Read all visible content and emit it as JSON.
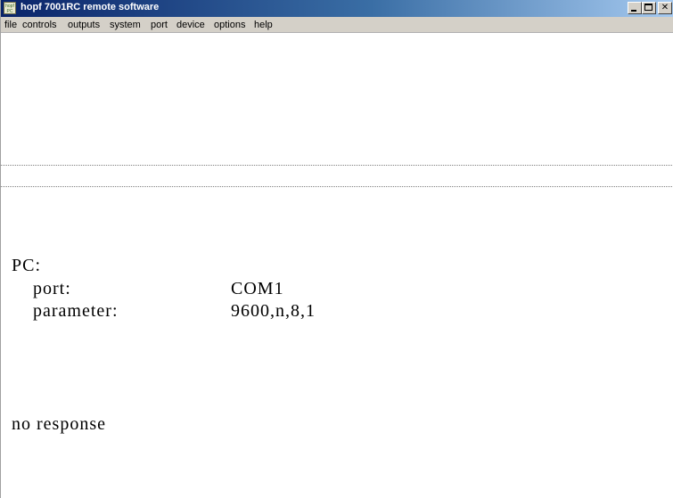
{
  "window": {
    "title": "hopf 7001RC remote software"
  },
  "menu": {
    "items": [
      "file",
      "controls",
      "outputs",
      "system",
      "port",
      "device",
      "options",
      "help"
    ]
  },
  "status": {
    "pc_heading": "PC:",
    "port_label": "port:",
    "port_value": "COM1",
    "parameter_label": "parameter:",
    "parameter_value": "9600,n,8,1",
    "response": "no response"
  },
  "icons": {
    "app": "hopf-pc-icon",
    "minimize": "minimize-icon",
    "maximize": "maximize-icon",
    "close": "close-icon"
  }
}
